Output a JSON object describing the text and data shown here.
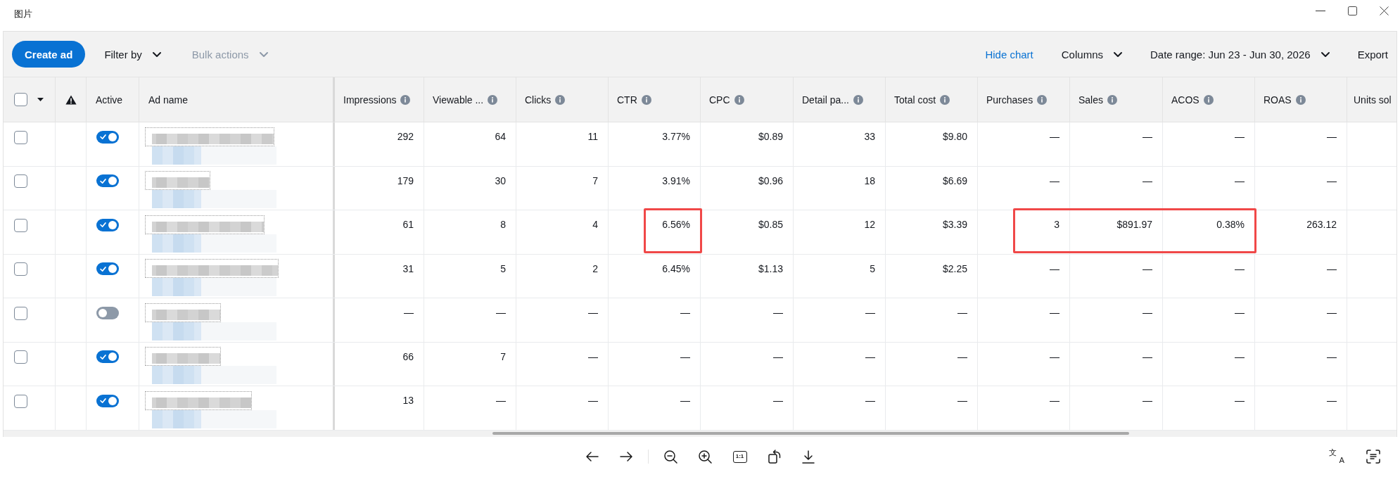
{
  "window": {
    "title": "图片"
  },
  "toolbar": {
    "left": [
      {
        "label": "Create ad",
        "kind": "primary",
        "disabled": false
      },
      {
        "label": "Filter by",
        "kind": "dropdown",
        "disabled": false
      },
      {
        "label": "Bulk actions",
        "kind": "dropdown",
        "disabled": true
      }
    ],
    "right": [
      {
        "label": "Hide chart",
        "kind": "link",
        "disabled": false
      },
      {
        "label": "Columns",
        "kind": "dropdown",
        "disabled": false
      },
      {
        "label": "Date range: Jun 23 - Jun 30, 2026",
        "kind": "dropdown",
        "disabled": false
      },
      {
        "label": "Export",
        "kind": "plain",
        "disabled": false
      }
    ]
  },
  "table": {
    "select_all": {
      "checked": false
    },
    "fixed_columns": [
      "Active",
      "Ad name"
    ],
    "metric_columns": [
      {
        "label": "Impressions",
        "info": true
      },
      {
        "label": "Viewable ...",
        "info": true
      },
      {
        "label": "Clicks",
        "info": true
      },
      {
        "label": "CTR",
        "info": true
      },
      {
        "label": "CPC",
        "info": true
      },
      {
        "label": "Detail pa...",
        "info": true
      },
      {
        "label": "Total cost",
        "info": true
      },
      {
        "label": "Purchases",
        "info": true
      },
      {
        "label": "Sales",
        "info": true
      },
      {
        "label": "ACOS",
        "info": true
      },
      {
        "label": "ROAS",
        "info": true
      },
      {
        "label": "Units sol",
        "info": false
      }
    ],
    "rows": [
      {
        "selected": false,
        "active": true,
        "cells": [
          {
            "text": "292",
            "highlighted": false
          },
          {
            "text": "64",
            "highlighted": false
          },
          {
            "text": "11",
            "highlighted": false
          },
          {
            "text": "3.77%",
            "highlighted": false
          },
          {
            "text": "$0.89",
            "highlighted": false
          },
          {
            "text": "33",
            "highlighted": false
          },
          {
            "text": "$9.80",
            "highlighted": false
          },
          {
            "text": "—",
            "highlighted": false
          },
          {
            "text": "—",
            "highlighted": false
          },
          {
            "text": "—",
            "highlighted": false
          },
          {
            "text": "—",
            "highlighted": false
          }
        ]
      },
      {
        "selected": false,
        "active": true,
        "cells": [
          {
            "text": "179",
            "highlighted": false
          },
          {
            "text": "30",
            "highlighted": false
          },
          {
            "text": "7",
            "highlighted": false
          },
          {
            "text": "3.91%",
            "highlighted": false
          },
          {
            "text": "$0.96",
            "highlighted": false
          },
          {
            "text": "18",
            "highlighted": false
          },
          {
            "text": "$6.69",
            "highlighted": false
          },
          {
            "text": "—",
            "highlighted": false
          },
          {
            "text": "—",
            "highlighted": false
          },
          {
            "text": "—",
            "highlighted": false
          },
          {
            "text": "—",
            "highlighted": false
          }
        ]
      },
      {
        "selected": false,
        "active": true,
        "cells": [
          {
            "text": "61",
            "highlighted": false
          },
          {
            "text": "8",
            "highlighted": false
          },
          {
            "text": "4",
            "highlighted": false
          },
          {
            "text": "6.56%",
            "highlighted": true
          },
          {
            "text": "$0.85",
            "highlighted": false
          },
          {
            "text": "12",
            "highlighted": false
          },
          {
            "text": "$3.39",
            "highlighted": false
          },
          {
            "text": "3",
            "highlighted": true
          },
          {
            "text": "$891.97",
            "highlighted": true
          },
          {
            "text": "0.38%",
            "highlighted": true
          },
          {
            "text": "263.12",
            "highlighted": false
          }
        ]
      },
      {
        "selected": false,
        "active": true,
        "cells": [
          {
            "text": "31",
            "highlighted": false
          },
          {
            "text": "5",
            "highlighted": false
          },
          {
            "text": "2",
            "highlighted": false
          },
          {
            "text": "6.45%",
            "highlighted": false
          },
          {
            "text": "$1.13",
            "highlighted": false
          },
          {
            "text": "5",
            "highlighted": false
          },
          {
            "text": "$2.25",
            "highlighted": false
          },
          {
            "text": "—",
            "highlighted": false
          },
          {
            "text": "—",
            "highlighted": false
          },
          {
            "text": "—",
            "highlighted": false
          },
          {
            "text": "—",
            "highlighted": false
          }
        ]
      },
      {
        "selected": false,
        "active": false,
        "cells": [
          {
            "text": "—",
            "highlighted": false
          },
          {
            "text": "—",
            "highlighted": false
          },
          {
            "text": "—",
            "highlighted": false
          },
          {
            "text": "—",
            "highlighted": false
          },
          {
            "text": "—",
            "highlighted": false
          },
          {
            "text": "—",
            "highlighted": false
          },
          {
            "text": "—",
            "highlighted": false
          },
          {
            "text": "—",
            "highlighted": false
          },
          {
            "text": "—",
            "highlighted": false
          },
          {
            "text": "—",
            "highlighted": false
          },
          {
            "text": "—",
            "highlighted": false
          }
        ]
      },
      {
        "selected": false,
        "active": true,
        "cells": [
          {
            "text": "66",
            "highlighted": false
          },
          {
            "text": "7",
            "highlighted": false
          },
          {
            "text": "—",
            "highlighted": false
          },
          {
            "text": "—",
            "highlighted": false
          },
          {
            "text": "—",
            "highlighted": false
          },
          {
            "text": "—",
            "highlighted": false
          },
          {
            "text": "—",
            "highlighted": false
          },
          {
            "text": "—",
            "highlighted": false
          },
          {
            "text": "—",
            "highlighted": false
          },
          {
            "text": "—",
            "highlighted": false
          },
          {
            "text": "—",
            "highlighted": false
          }
        ]
      },
      {
        "selected": false,
        "active": true,
        "cells": [
          {
            "text": "13",
            "highlighted": false
          },
          {
            "text": "—",
            "highlighted": false
          },
          {
            "text": "—",
            "highlighted": false
          },
          {
            "text": "—",
            "highlighted": false
          },
          {
            "text": "—",
            "highlighted": false
          },
          {
            "text": "—",
            "highlighted": false
          },
          {
            "text": "—",
            "highlighted": false
          },
          {
            "text": "—",
            "highlighted": false
          },
          {
            "text": "—",
            "highlighted": false
          },
          {
            "text": "—",
            "highlighted": false
          },
          {
            "text": "—",
            "highlighted": false
          }
        ]
      }
    ]
  },
  "viewer_toolbar": {
    "actual_size_label": "1:1",
    "translate_glyphs": [
      "文",
      "A"
    ]
  }
}
